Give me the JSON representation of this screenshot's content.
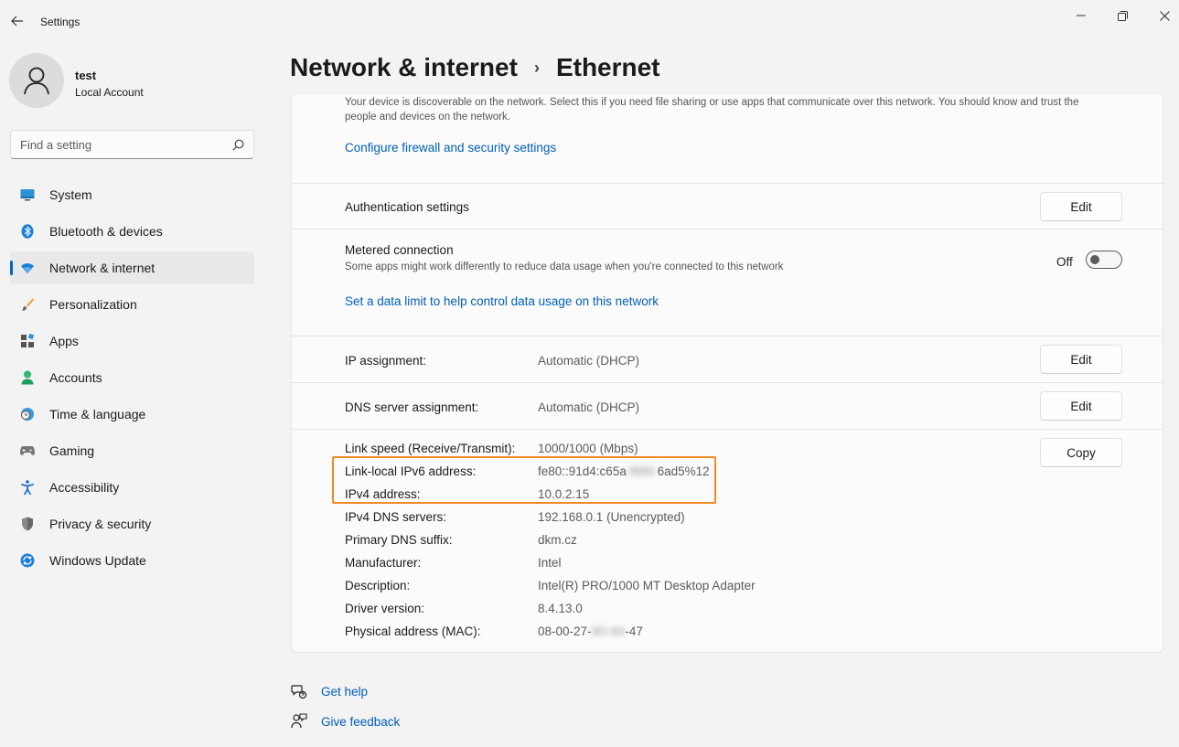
{
  "window": {
    "title": "Settings",
    "controls": [
      "minimize-icon",
      "maximize-icon",
      "close-icon"
    ]
  },
  "profile": {
    "name": "test",
    "account_type": "Local Account"
  },
  "search": {
    "placeholder": "Find a setting"
  },
  "nav": {
    "items": [
      {
        "label": "System",
        "icon": "monitor-icon"
      },
      {
        "label": "Bluetooth & devices",
        "icon": "bluetooth-icon"
      },
      {
        "label": "Network & internet",
        "icon": "wifi-icon",
        "active": true
      },
      {
        "label": "Personalization",
        "icon": "brush-icon"
      },
      {
        "label": "Apps",
        "icon": "apps-icon"
      },
      {
        "label": "Accounts",
        "icon": "person-icon"
      },
      {
        "label": "Time & language",
        "icon": "globe-clock-icon"
      },
      {
        "label": "Gaming",
        "icon": "gamepad-icon"
      },
      {
        "label": "Accessibility",
        "icon": "accessibility-icon"
      },
      {
        "label": "Privacy & security",
        "icon": "shield-icon"
      },
      {
        "label": "Windows Update",
        "icon": "update-icon"
      }
    ]
  },
  "breadcrumb": {
    "parent": "Network & internet",
    "separator": "›",
    "current": "Ethernet"
  },
  "network_profile": {
    "description": "Your device is discoverable on the network. Select this if you need file sharing or use apps that communicate over this network. You should know and trust the people and devices on the network.",
    "firewall_link": "Configure firewall and security settings"
  },
  "auth": {
    "label": "Authentication settings",
    "button": "Edit"
  },
  "metered": {
    "label": "Metered connection",
    "sub": "Some apps might work differently to reduce data usage when you're connected to this network",
    "state": "Off",
    "link": "Set a data limit to help control data usage on this network"
  },
  "ip": {
    "label": "IP assignment:",
    "value": "Automatic (DHCP)",
    "button": "Edit"
  },
  "dns": {
    "label": "DNS server assignment:",
    "value": "Automatic (DHCP)",
    "button": "Edit"
  },
  "properties": {
    "copy_button": "Copy",
    "link_speed_label": "Link speed (Receive/Transmit):",
    "link_speed": "1000/1000 (Mbps)",
    "ipv6_label": "Link-local IPv6 address:",
    "ipv6_a": "fe80::91d4:c65a",
    "ipv6_blur": ":f886:",
    "ipv6_b": "6ad5%12",
    "ipv4_label": "IPv4 address:",
    "ipv4": "10.0.2.15",
    "dns_servers_label": "IPv4 DNS servers:",
    "dns_servers": "192.168.0.1 (Unencrypted)",
    "dns_suffix_label": "Primary DNS suffix:",
    "dns_suffix": "dkm.cz",
    "manufacturer_label": "Manufacturer:",
    "manufacturer": "Intel",
    "description_label": "Description:",
    "description": "Intel(R) PRO/1000 MT Desktop Adapter",
    "driver_label": "Driver version:",
    "driver": "8.4.13.0",
    "mac_label": "Physical address (MAC):",
    "mac_a": "08-00-27-",
    "mac_blur": "9D-84",
    "mac_b": "-47"
  },
  "footer": {
    "help": "Get help",
    "feedback": "Give feedback"
  },
  "colors": {
    "accent": "#0067c0",
    "link": "#005fb8",
    "highlight": "#f08a24"
  }
}
